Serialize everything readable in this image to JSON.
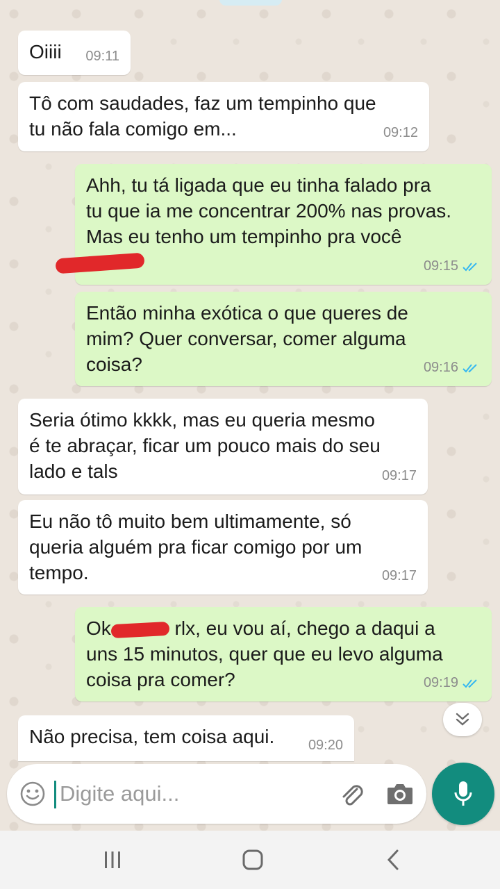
{
  "colors": {
    "accent": "#128c7e",
    "incoming_bubble": "#ffffff",
    "outgoing_bubble": "#dcf8c6",
    "read_ticks": "#34b7f1"
  },
  "messages": [
    {
      "direction": "in",
      "text": "Oiiii",
      "time": "09:11"
    },
    {
      "direction": "in",
      "text": "Tô com saudades, faz um tempinho que\ntu não fala comigo em...",
      "time": "09:12"
    },
    {
      "direction": "out",
      "text": "Ahh, tu tá ligada que eu tinha falado pra\ntu que ia me concentrar 200% nas provas.\nMas eu tenho um tempinho pra você",
      "time": "09:15",
      "status": "read"
    },
    {
      "direction": "out",
      "text": "Então minha exótica o que queres de\nmim? Quer conversar, comer alguma\ncoisa?",
      "time": "09:16",
      "status": "read"
    },
    {
      "direction": "in",
      "text": "Seria ótimo kkkk, mas eu  queria mesmo\né te abraçar, ficar um pouco mais do seu\nlado e tals",
      "time": "09:17"
    },
    {
      "direction": "in",
      "text": "Eu não tô muito bem ultimamente, só\nqueria alguém pra ficar comigo por um\ntempo.",
      "time": "09:17"
    },
    {
      "direction": "out",
      "text_before": "Ok",
      "text_after": " rlx, eu vou aí, chego a daqui a\nuns 15 minutos, quer que eu levo alguma\ncoisa pra comer?",
      "time": "09:19",
      "status": "read"
    },
    {
      "direction": "in",
      "text": "Não precisa, tem coisa aqui.",
      "time": "09:20"
    }
  ],
  "composer": {
    "placeholder": "Digite aqui...",
    "value": ""
  },
  "icons": {
    "emoji": "emoji-icon",
    "attach": "paperclip-icon",
    "camera": "camera-icon",
    "mic": "microphone-icon",
    "scroll": "chevron-double-down-icon",
    "nav_recents": "recents-icon",
    "nav_home": "home-icon",
    "nav_back": "back-icon"
  }
}
